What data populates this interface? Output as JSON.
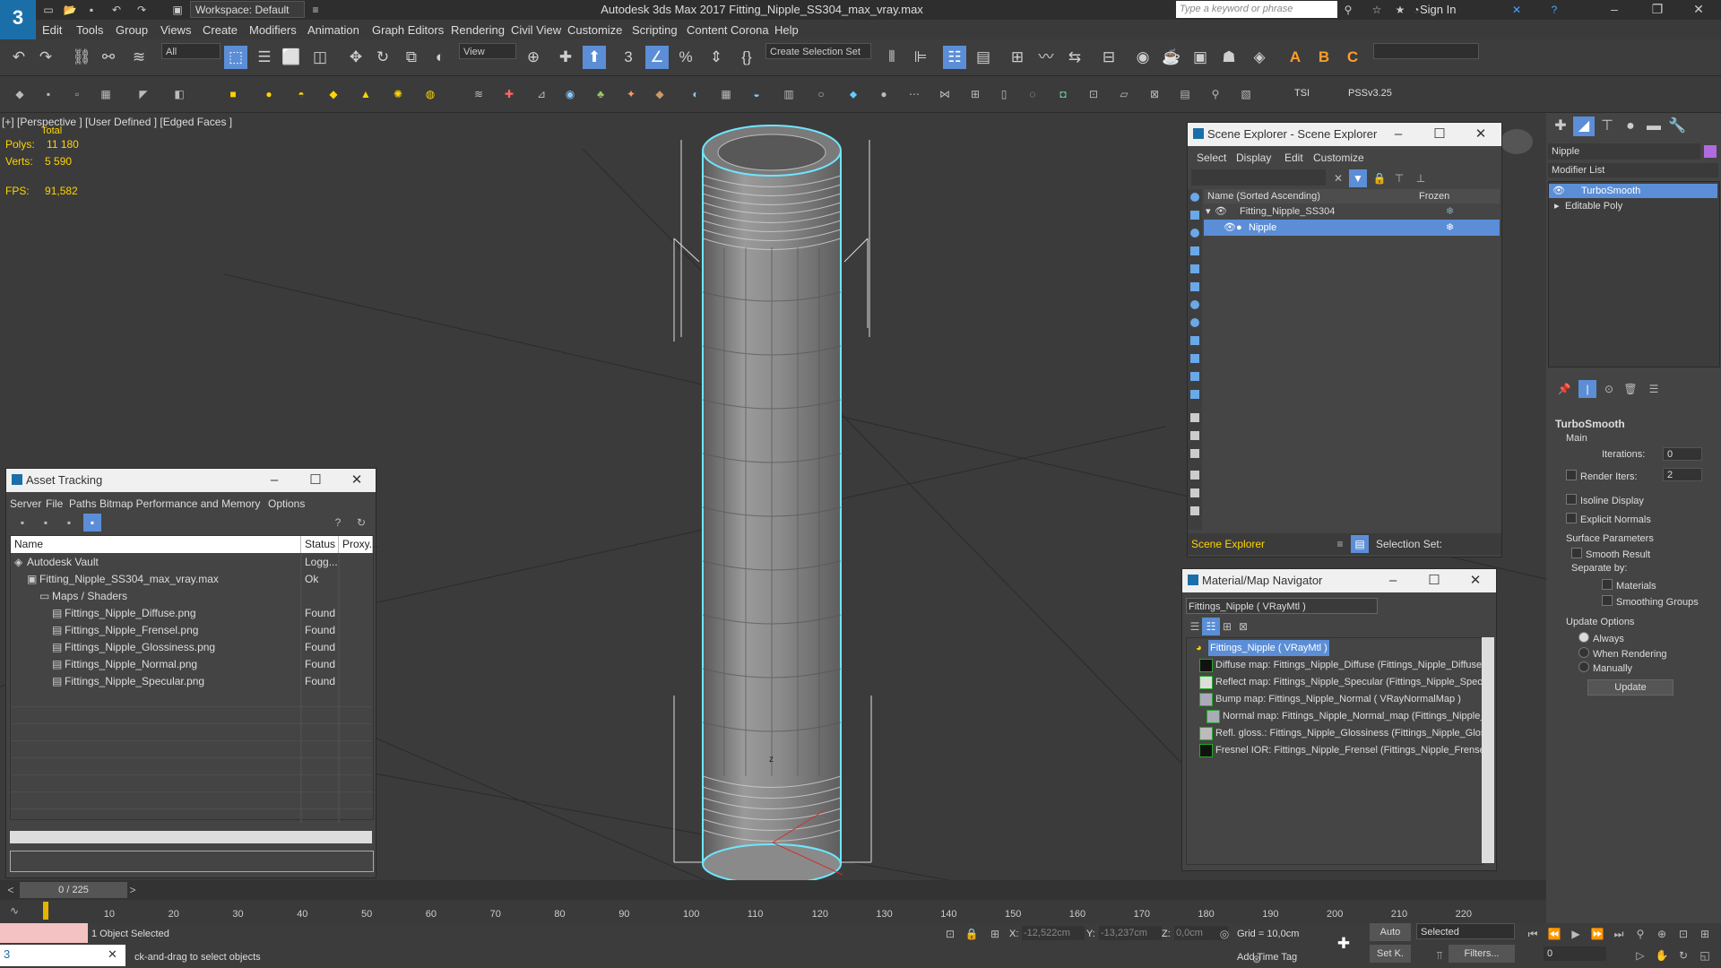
{
  "app": {
    "logo": "3",
    "workspace": "Workspace: Default",
    "window_title": "Autodesk 3ds Max 2017       Fitting_Nipple_SS304_max_vray.max",
    "search_placeholder": "Type a keyword or phrase",
    "sign_in": "Sign In"
  },
  "menus": [
    "Edit",
    "Tools",
    "Group",
    "Views",
    "Create",
    "Modifiers",
    "Animation",
    "Graph Editors",
    "Rendering",
    "Civil View",
    "Customize",
    "Scripting",
    "Content",
    "Corona",
    "Help"
  ],
  "toolbar": {
    "filter_all": "All",
    "ref_coord": "View",
    "selection_set": "Create Selection Set",
    "tsi": "TSI",
    "pss": "PSSv3.25"
  },
  "viewport": {
    "label": "[+] [Perspective ] [User Defined ] [Edged Faces ]",
    "stats_total": "Total",
    "polys_label": "Polys:",
    "polys_value": "11 180",
    "verts_label": "Verts:",
    "verts_value": "5 590",
    "fps_label": "FPS:",
    "fps_value": "91,582",
    "axis_z": "z"
  },
  "scene_explorer": {
    "title": "Scene Explorer - Scene Explorer",
    "menus": [
      "Select",
      "Display",
      "Edit",
      "Customize"
    ],
    "col_name": "Name (Sorted Ascending)",
    "col_frozen": "Frozen",
    "rows": [
      "Fitting_Nipple_SS304",
      "Nipple"
    ],
    "footer_name": "Scene Explorer",
    "footer_set": "Selection Set:"
  },
  "asset_tracking": {
    "title": "Asset Tracking",
    "menus": [
      "Server",
      "File",
      "Paths",
      "Bitmap Performance and Memory",
      "Options"
    ],
    "col_name": "Name",
    "col_status": "Status",
    "col_proxy": "Proxy...",
    "rows": [
      {
        "name": "Autodesk Vault",
        "status": "Logg...",
        "indent": 0
      },
      {
        "name": "Fitting_Nipple_SS304_max_vray.max",
        "status": "Ok",
        "indent": 1
      },
      {
        "name": "Maps / Shaders",
        "status": "",
        "indent": 2
      },
      {
        "name": "Fittings_Nipple_Diffuse.png",
        "status": "Found",
        "indent": 3
      },
      {
        "name": "Fittings_Nipple_Frensel.png",
        "status": "Found",
        "indent": 3
      },
      {
        "name": "Fittings_Nipple_Glossiness.png",
        "status": "Found",
        "indent": 3
      },
      {
        "name": "Fittings_Nipple_Normal.png",
        "status": "Found",
        "indent": 3
      },
      {
        "name": "Fittings_Nipple_Specular.png",
        "status": "Found",
        "indent": 3
      }
    ]
  },
  "material_nav": {
    "title": "Material/Map Navigator",
    "current": "Fittings_Nipple  ( VRayMtl )",
    "root": "Fittings_Nipple  ( VRayMtl )",
    "rows": [
      "Diffuse map: Fittings_Nipple_Diffuse (Fittings_Nipple_Diffuse",
      "Reflect map: Fittings_Nipple_Specular (Fittings_Nipple_Specu",
      "Bump map: Fittings_Nipple_Normal  ( VRayNormalMap )",
      "Normal map: Fittings_Nipple_Normal_map (Fittings_Nipple_",
      "Refl. gloss.: Fittings_Nipple_Glossiness (Fittings_Nipple_Glossi",
      "Fresnel IOR: Fittings_Nipple_Frensel (Fittings_Nipple_Frensel"
    ]
  },
  "command_panel": {
    "object_name": "Nipple",
    "modifier_list": "Modifier List",
    "stack": [
      "TurboSmooth",
      "Editable Poly"
    ],
    "rollout": "TurboSmooth",
    "main": "Main",
    "iterations_label": "Iterations:",
    "iterations_value": "0",
    "render_iters_label": "Render Iters:",
    "render_iters_value": "2",
    "isoline": "Isoline Display",
    "explicit_normals": "Explicit Normals",
    "surface_params": "Surface Parameters",
    "smooth_result": "Smooth Result",
    "separate_by": "Separate by:",
    "materials": "Materials",
    "smoothing_groups": "Smoothing Groups",
    "update_options": "Update Options",
    "always": "Always",
    "when_rendering": "When Rendering",
    "manually": "Manually",
    "update_button": "Update"
  },
  "timeline": {
    "frame": "0 / 225",
    "ticks": [
      "10",
      "20",
      "30",
      "40",
      "50",
      "60",
      "70",
      "80",
      "90",
      "100",
      "110",
      "120",
      "130",
      "140",
      "150",
      "160",
      "170",
      "180",
      "190",
      "200",
      "210",
      "220"
    ]
  },
  "status": {
    "selected": "1 Object Selected",
    "prompt": "ck-and-drag to select objects",
    "x_label": "X:",
    "x_value": "-12,522cm",
    "y_label": "Y:",
    "y_value": "-13,237cm",
    "z_label": "Z:",
    "z_value": "0,0cm",
    "grid": "Grid = 10,0cm",
    "add_time_tag": "Add Time Tag",
    "auto": "Auto",
    "set_k": "Set K.",
    "selected_drop": "Selected",
    "filters": "Filters...",
    "frame_field": "0"
  }
}
